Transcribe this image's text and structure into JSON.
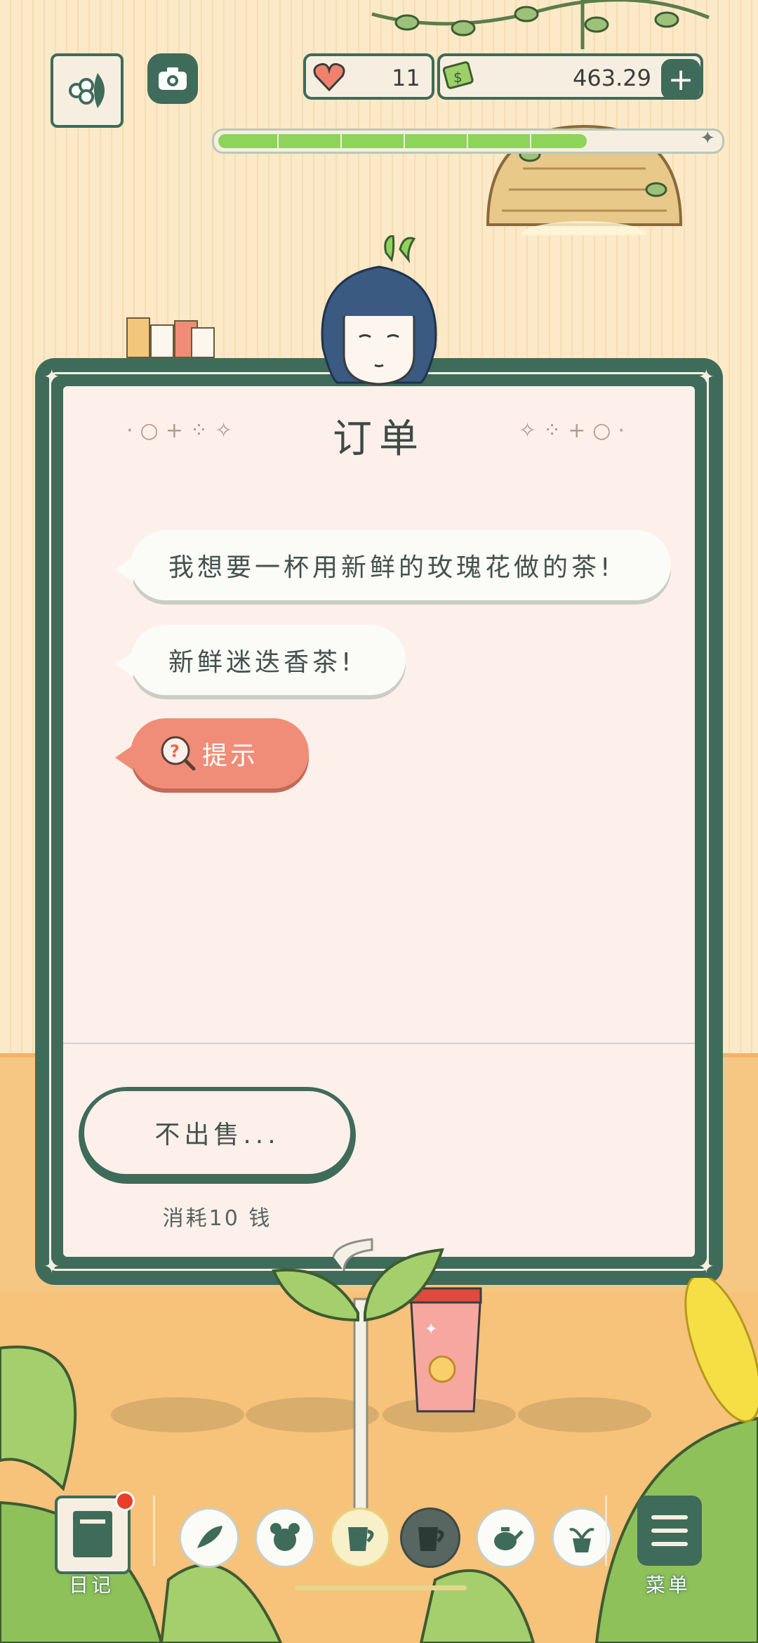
{
  "hud": {
    "hearts": "11",
    "money": "463.29",
    "add_label": "+",
    "xp_progress": 0.74
  },
  "order": {
    "title": "订单",
    "requests": [
      {
        "text": "我想要一杯用新鲜的玫瑰花做的茶!"
      },
      {
        "text": "新鲜迷迭香茶!"
      }
    ],
    "hint_label": "提示",
    "nosell_label": "不出售...",
    "nosell_cost": "消耗10 钱"
  },
  "nav": {
    "diary_label": "日记",
    "menu_label": "菜单",
    "items": [
      {
        "icon": "leaves-icon"
      },
      {
        "icon": "bear-icon"
      },
      {
        "icon": "cup-icon"
      },
      {
        "icon": "mug-icon"
      },
      {
        "icon": "teapot-icon"
      },
      {
        "icon": "plant-pot-icon"
      }
    ]
  },
  "colors": {
    "frame_green": "#3f6b5a",
    "hint_orange": "#f08d78",
    "paper": "#fdf0ea"
  }
}
